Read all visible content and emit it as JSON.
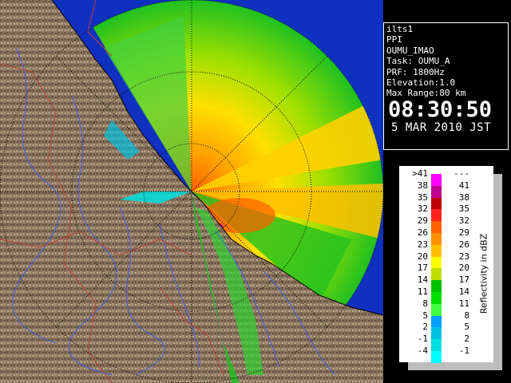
{
  "info": {
    "lines": [
      "ilts1",
      "PPI",
      "OUMU_IMAO",
      "Task: OUMU_A",
      "PRF: 1800Hz",
      "Elevation:1.0",
      "Max Range:80 km"
    ],
    "time": "08:30:50",
    "date": "5 MAR 2010 JST"
  },
  "legend": {
    "title": "Reflectivity in dBZ",
    "rows": [
      {
        "low": ">41",
        "high": "---",
        "color": "#ff00ff"
      },
      {
        "low": "38",
        "high": "41",
        "color": "#c00090"
      },
      {
        "low": "35",
        "high": "38",
        "color": "#c00000"
      },
      {
        "low": "32",
        "high": "35",
        "color": "#ff2020"
      },
      {
        "low": "29",
        "high": "32",
        "color": "#ff6000"
      },
      {
        "low": "26",
        "high": "29",
        "color": "#ff9000"
      },
      {
        "low": "23",
        "high": "26",
        "color": "#ffc000"
      },
      {
        "low": "20",
        "high": "23",
        "color": "#ffff00"
      },
      {
        "low": "17",
        "high": "20",
        "color": "#c0e000"
      },
      {
        "low": "14",
        "high": "17",
        "color": "#00c000"
      },
      {
        "low": "11",
        "high": "14",
        "color": "#00e000"
      },
      {
        "low": "8",
        "high": "11",
        "color": "#40ff40"
      },
      {
        "low": "5",
        "high": "8",
        "color": "#00a0ff"
      },
      {
        "low": "2",
        "high": "5",
        "color": "#00c0e0"
      },
      {
        "low": "-1",
        "high": "2",
        "color": "#00e0e0"
      },
      {
        "low": "-4",
        "high": "-1",
        "color": "#00ffff"
      }
    ]
  },
  "colors": {
    "land": "#8a7560",
    "sea": "#1030c0",
    "rivers": "#4060e0",
    "borders": "#c04030",
    "range_rings": "#000000"
  }
}
